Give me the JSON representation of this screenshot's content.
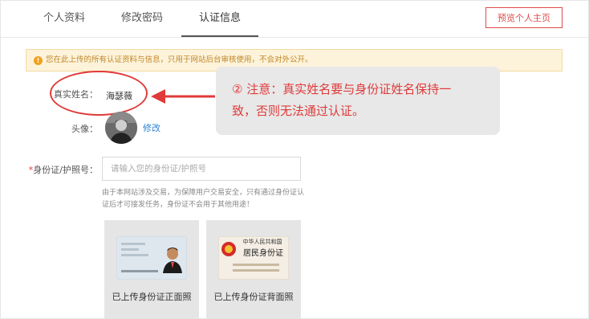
{
  "tabs": [
    {
      "label": "个人资料"
    },
    {
      "label": "修改密码"
    },
    {
      "label": "认证信息"
    }
  ],
  "preview_button": "预览个人主页",
  "notice": "您在此上传的所有认证资料与信息，只用于网站后台审核使用，不会对外公开。",
  "notice_icon": "!",
  "fields": {
    "real_name_label": "真实姓名：",
    "real_name_value": "海瑟薇",
    "avatar_label": "头像：",
    "edit_link": "修改",
    "id_required_mark": "*",
    "id_label": "身份证/护照号：",
    "id_placeholder": "请输入您的身份证/护照号",
    "hint": "由于本网站涉及交易，为保障用户交易安全，只有通过身份证认证后才可接发任务，身份证不会用于其他用途！"
  },
  "callout": {
    "line1": "② 注意：真实姓名要与身份证姓名保持一",
    "line2": "致，否则无法通过认证。"
  },
  "uploads": {
    "front_label": "已上传身份证正面照",
    "back_label": "已上传身份证背面照",
    "back_card_line1": "中华人民共和国",
    "back_card_line2": "居民身份证"
  },
  "colors": {
    "accent_red": "#e03a3a",
    "link_blue": "#2d84d6",
    "notice_bg": "#fdf3da"
  }
}
